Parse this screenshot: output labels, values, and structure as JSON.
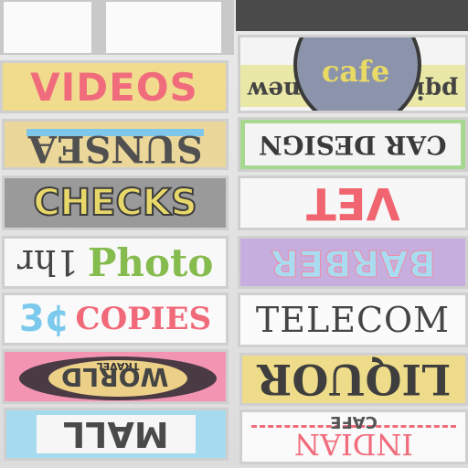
{
  "signs": {
    "videos": "VIDEOS",
    "sunsea": "SUNSEA",
    "checks": "CHECKS",
    "photo_prefix": "1hr",
    "photo": "Photo",
    "copies_price": "3¢",
    "copies": "COPIES",
    "travel_small": "TRAVEL",
    "travel": "WORLD",
    "mall": "MALL",
    "cafe": "cafe",
    "cafe_left": "new",
    "cafe_right": "pqi",
    "car_design": "CAR DESIGN",
    "vet": "VET",
    "barber": "BARBER",
    "telecom": "TELECOM",
    "liquor": "LIQUOR",
    "indian_small": "CAFE",
    "indian": "INDIAN"
  },
  "colors": {
    "pink": "#f06c7c",
    "yellow": "#f1dc8e",
    "blue": "#a6dbef",
    "green": "#a6d890",
    "purple": "#c6aedf"
  }
}
